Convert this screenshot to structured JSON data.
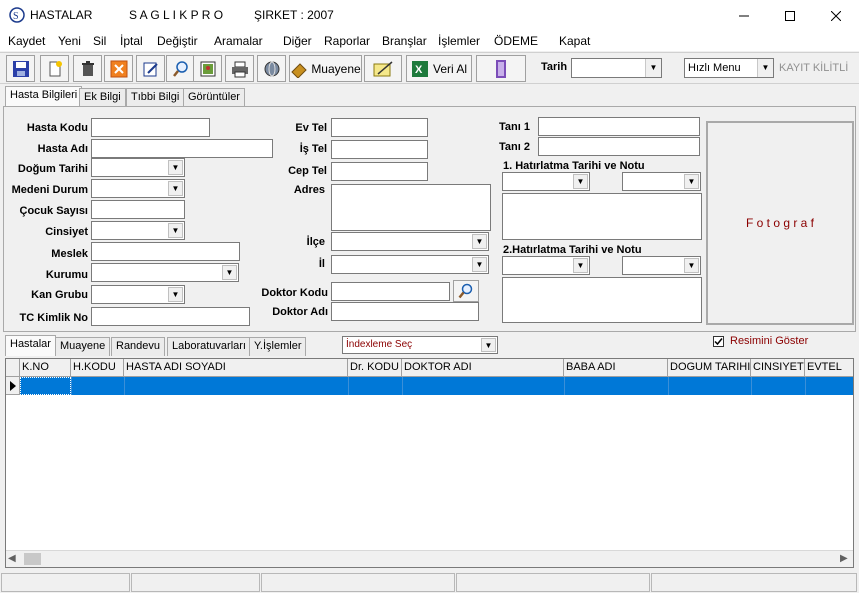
{
  "window": {
    "title": "HASTALAR",
    "product": "S A G L I K P R O",
    "company": "ŞIRKET : 2007"
  },
  "menu": [
    "Kaydet",
    "Yeni",
    "Sil",
    "İptal",
    "Değiştir",
    "Aramalar",
    "Diğer",
    "Raporlar",
    "Branşlar",
    "İşlemler",
    "ÖDEME",
    "Kapat"
  ],
  "toolbar": {
    "muayene_label": "Muayene",
    "veri_al_label": "Veri Al",
    "tarih_label": "Tarih",
    "hizli_menu_value": "Hızlı Menu",
    "kayit_kilitli_label": "KAYIT KİLİTLİ"
  },
  "tabs_top": [
    "Hasta Bilgileri",
    "Ek Bilgi",
    "Tıbbi Bilgi",
    "Görüntüler"
  ],
  "form": {
    "hasta_kodu": "Hasta Kodu",
    "hasta_adi": "Hasta Adı",
    "dogum_tarihi": "Doğum Tarihi",
    "medeni_durum": "Medeni Durum",
    "cocuk_sayisi": "Çocuk Sayısı",
    "cinsiyet": "Cinsiyet",
    "meslek": "Meslek",
    "kurumu": "Kurumu",
    "kan_grubu": "Kan Grubu",
    "tc_kimlik": "TC Kimlik No",
    "ev_tel": "Ev Tel",
    "is_tel": "İş Tel",
    "cep_tel": "Cep Tel",
    "adres": "Adres",
    "ilce": "İlçe",
    "il": "İl",
    "doktor_kodu": "Doktor Kodu",
    "doktor_adi": "Doktor Adı",
    "tani1": "Tanı 1",
    "tani2": "Tanı 2",
    "hatirlatma1": "1. Hatırlatma Tarihi ve Notu",
    "hatirlatma2": "2.Hatırlatma Tarihi ve Notu",
    "fotograf": "F o t o g r a f"
  },
  "tabs_bottom": [
    "Hastalar",
    "Muayene",
    "Randevu",
    "Laboratuvarları",
    "Y.İşlemler"
  ],
  "index_select": "İndexleme  Seç",
  "show_picture_label": "Resimini Göster",
  "grid_columns": [
    "K.NO",
    "H.KODU",
    "HASTA ADI SOYADI",
    "Dr. KODU",
    "DOKTOR ADI",
    "BABA ADI",
    "DOGUM TARIHI",
    "CINSIYET",
    "EVTEL"
  ],
  "colors": {
    "accent": "#0078d7",
    "fotograf_text": "#8b0000",
    "index_text": "#8b0000"
  }
}
